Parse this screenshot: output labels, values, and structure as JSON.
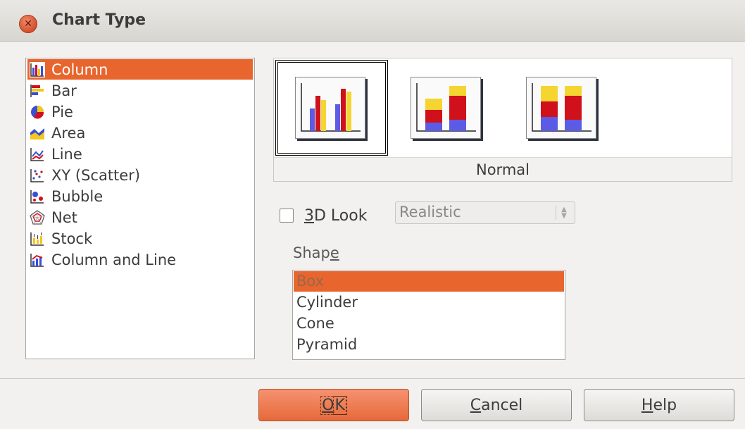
{
  "window": {
    "title": "Chart Type"
  },
  "chart_types": [
    {
      "label": "Column",
      "icon": "column-chart-icon",
      "selected": true
    },
    {
      "label": "Bar",
      "icon": "bar-chart-icon",
      "selected": false
    },
    {
      "label": "Pie",
      "icon": "pie-chart-icon",
      "selected": false
    },
    {
      "label": "Area",
      "icon": "area-chart-icon",
      "selected": false
    },
    {
      "label": "Line",
      "icon": "line-chart-icon",
      "selected": false
    },
    {
      "label": "XY (Scatter)",
      "icon": "scatter-chart-icon",
      "selected": false
    },
    {
      "label": "Bubble",
      "icon": "bubble-chart-icon",
      "selected": false
    },
    {
      "label": "Net",
      "icon": "net-chart-icon",
      "selected": false
    },
    {
      "label": "Stock",
      "icon": "stock-chart-icon",
      "selected": false
    },
    {
      "label": "Column and Line",
      "icon": "column-and-line-chart-icon",
      "selected": false
    }
  ],
  "variants": {
    "caption": "Normal",
    "items": [
      {
        "name": "normal",
        "selected": true
      },
      {
        "name": "stacked",
        "selected": false
      },
      {
        "name": "percent-stacked",
        "selected": false
      }
    ]
  },
  "options": {
    "look3d_prefix": "",
    "look3d_mnemonic": "3",
    "look3d_rest": "D Look",
    "look3d_checked": false,
    "look3d_style": "Realistic"
  },
  "shape": {
    "label_prefix": "Shap",
    "label_mnemonic": "e",
    "items": [
      "Box",
      "Cylinder",
      "Cone",
      "Pyramid"
    ],
    "selected": "Box"
  },
  "buttons": {
    "ok_mnemonic": "O",
    "ok_rest": "K",
    "cancel_mnemonic": "C",
    "cancel_rest": "ancel",
    "help_mnemonic": "H",
    "help_rest": "elp"
  },
  "colors": {
    "accent": "#e8652d",
    "series_blue": "#5b5be6",
    "series_red": "#d0101a",
    "series_yellow": "#f5d530"
  }
}
